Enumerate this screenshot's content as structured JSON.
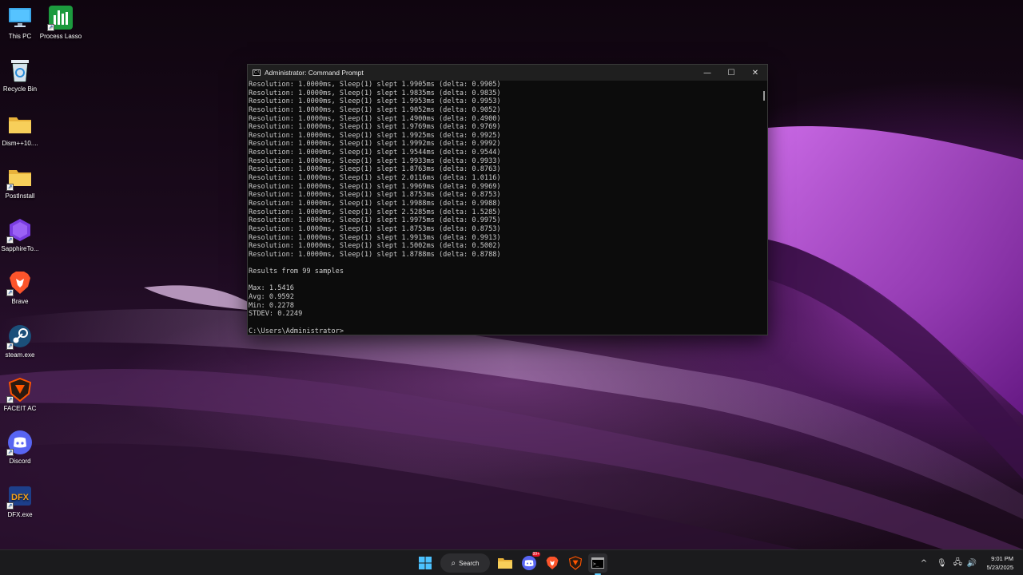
{
  "desktop_icons": [
    {
      "label": "This PC",
      "icon": "monitor-icon"
    },
    {
      "label": "Process Lasso",
      "icon": "process-lasso-icon"
    },
    {
      "label": "Recycle Bin",
      "icon": "recycle-bin-icon"
    },
    {
      "label": "Dism++10....",
      "icon": "folder-icon"
    },
    {
      "label": "PostInstall",
      "icon": "folder-icon"
    },
    {
      "label": "SapphireTo...",
      "icon": "sapphire-icon"
    },
    {
      "label": "Brave",
      "icon": "brave-icon"
    },
    {
      "label": "steam.exe",
      "icon": "steam-icon"
    },
    {
      "label": "FACEIT AC",
      "icon": "faceit-icon"
    },
    {
      "label": "Discord",
      "icon": "discord-icon"
    },
    {
      "label": "DFX.exe",
      "icon": "dfx-icon"
    }
  ],
  "window": {
    "title": "Administrator: Command Prompt",
    "minimize_glyph": "—",
    "maximize_glyph": "☐",
    "close_glyph": "✕"
  },
  "console": {
    "lines": [
      "Resolution: 1.0000ms, Sleep(1) slept 1.9905ms (delta: 0.9905)",
      "Resolution: 1.0000ms, Sleep(1) slept 1.9835ms (delta: 0.9835)",
      "Resolution: 1.0000ms, Sleep(1) slept 1.9953ms (delta: 0.9953)",
      "Resolution: 1.0000ms, Sleep(1) slept 1.9052ms (delta: 0.9052)",
      "Resolution: 1.0000ms, Sleep(1) slept 1.4900ms (delta: 0.4900)",
      "Resolution: 1.0000ms, Sleep(1) slept 1.9769ms (delta: 0.9769)",
      "Resolution: 1.0000ms, Sleep(1) slept 1.9925ms (delta: 0.9925)",
      "Resolution: 1.0000ms, Sleep(1) slept 1.9992ms (delta: 0.9992)",
      "Resolution: 1.0000ms, Sleep(1) slept 1.9544ms (delta: 0.9544)",
      "Resolution: 1.0000ms, Sleep(1) slept 1.9933ms (delta: 0.9933)",
      "Resolution: 1.0000ms, Sleep(1) slept 1.8763ms (delta: 0.8763)",
      "Resolution: 1.0000ms, Sleep(1) slept 2.0116ms (delta: 1.0116)",
      "Resolution: 1.0000ms, Sleep(1) slept 1.9969ms (delta: 0.9969)",
      "Resolution: 1.0000ms, Sleep(1) slept 1.8753ms (delta: 0.8753)",
      "Resolution: 1.0000ms, Sleep(1) slept 1.9988ms (delta: 0.9988)",
      "Resolution: 1.0000ms, Sleep(1) slept 2.5285ms (delta: 1.5285)",
      "Resolution: 1.0000ms, Sleep(1) slept 1.9975ms (delta: 0.9975)",
      "Resolution: 1.0000ms, Sleep(1) slept 1.8753ms (delta: 0.8753)",
      "Resolution: 1.0000ms, Sleep(1) slept 1.9913ms (delta: 0.9913)",
      "Resolution: 1.0000ms, Sleep(1) slept 1.5002ms (delta: 0.5002)",
      "Resolution: 1.0000ms, Sleep(1) slept 1.8788ms (delta: 0.8788)",
      "",
      "Results from 99 samples",
      "",
      "Max: 1.5416",
      "Avg: 0.9592",
      "Min: 0.2278",
      "STDEV: 0.2249",
      "",
      "C:\\Users\\Administrator>"
    ]
  },
  "taskbar": {
    "search_label": "Search",
    "discord_badge": "99+",
    "clock_time": "9:01 PM",
    "clock_date": "5/23/2025",
    "tray_chevron": "^"
  },
  "colors": {
    "console_bg": "#0c0c0c",
    "console_text": "#cccccc",
    "taskbar_bg": "#1b1b1d",
    "wallpaper_accent": "#b23cd8"
  }
}
